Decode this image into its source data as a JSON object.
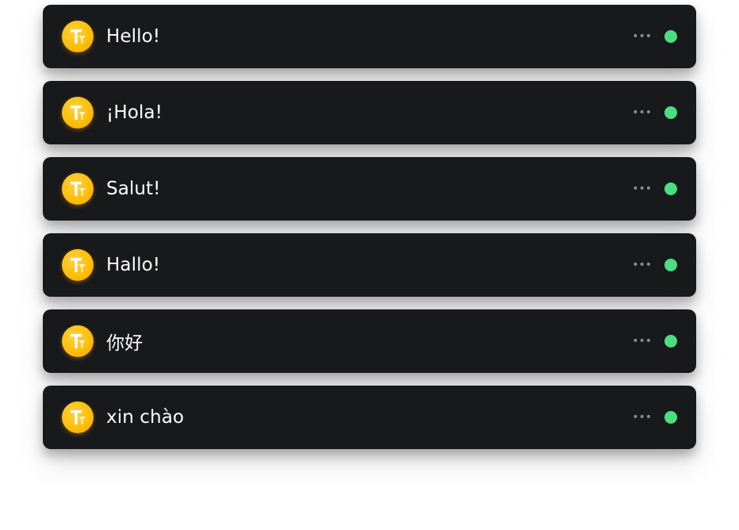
{
  "rows": [
    {
      "message": "Hello!",
      "more_icon": "more-horizontal-icon",
      "status_color": "#4ade80"
    },
    {
      "message": "¡Hola!",
      "more_icon": "more-horizontal-icon",
      "status_color": "#4ade80"
    },
    {
      "message": "Salut!",
      "more_icon": "more-horizontal-icon",
      "status_color": "#4ade80"
    },
    {
      "message": "Hallo!",
      "more_icon": "more-horizontal-icon",
      "status_color": "#4ade80"
    },
    {
      "message": "你好",
      "more_icon": "more-horizontal-icon",
      "status_color": "#4ade80"
    },
    {
      "message": "xin chào",
      "more_icon": "more-horizontal-icon",
      "status_color": "#4ade80"
    }
  ],
  "colors": {
    "row_background": "#18191b",
    "avatar_gold": "#ffbe0b",
    "status_online": "#4ade80"
  }
}
